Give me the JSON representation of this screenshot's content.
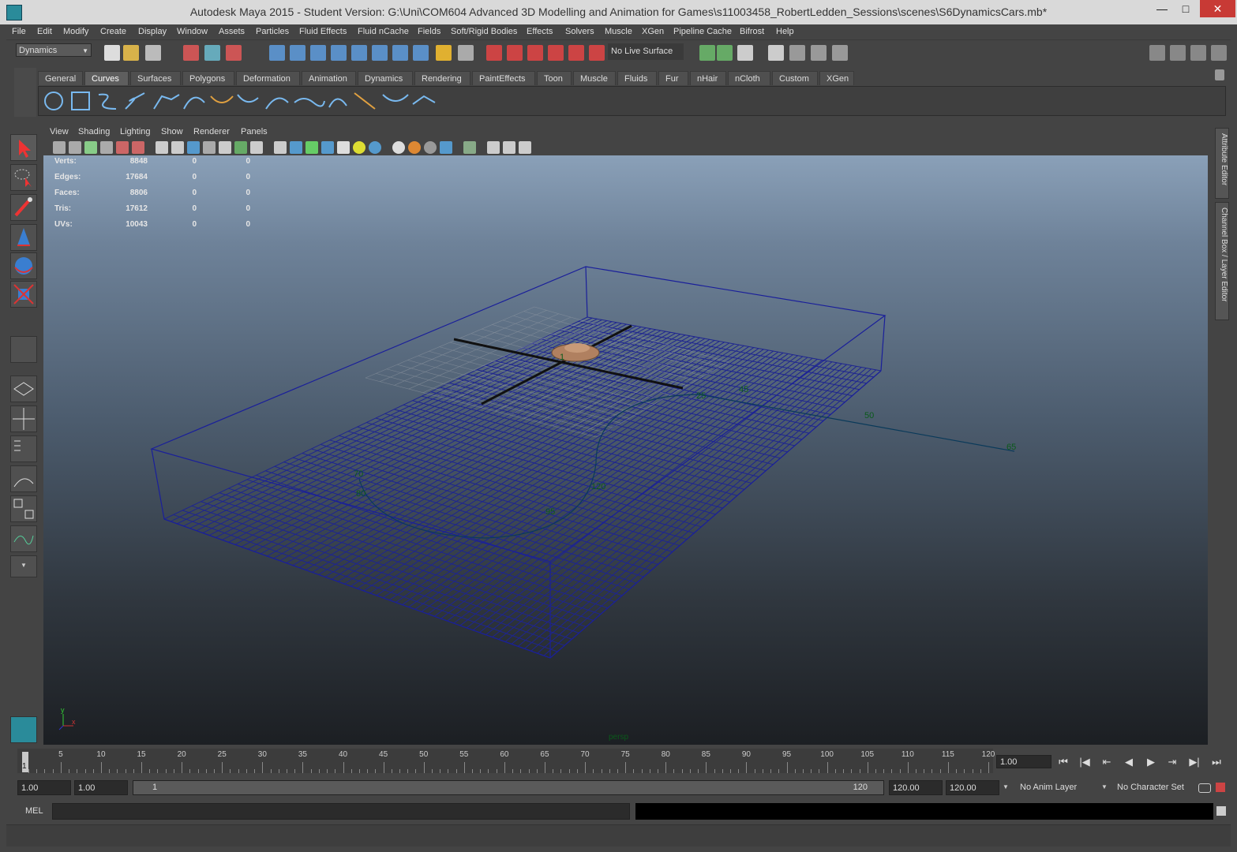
{
  "window": {
    "title": "Autodesk Maya 2015 - Student Version: G:\\Uni\\COM604 Advanced 3D Modelling and Animation for Games\\s11003458_RobertLedden_Sessions\\scenes\\S6DynamicsCars.mb*",
    "minimize": "—",
    "maximize": "□",
    "close": "✕"
  },
  "menu": [
    "File",
    "Edit",
    "Modify",
    "Create",
    "Display",
    "Window",
    "Assets",
    "Particles",
    "Fluid Effects",
    "Fluid nCache",
    "Fields",
    "Soft/Rigid Bodies",
    "Effects",
    "Solvers",
    "Muscle",
    "XGen",
    "Pipeline Cache",
    "Bifrost",
    "Help"
  ],
  "statusline": {
    "mode": "Dynamics",
    "live_surface": "No Live Surface"
  },
  "shelf": {
    "tabs": [
      "General",
      "Curves",
      "Surfaces",
      "Polygons",
      "Deformation",
      "Animation",
      "Dynamics",
      "Rendering",
      "PaintEffects",
      "Toon",
      "Muscle",
      "Fluids",
      "Fur",
      "nHair",
      "nCloth",
      "Custom",
      "XGen"
    ],
    "active_tab": "Curves"
  },
  "panel_menu": [
    "View",
    "Shading",
    "Lighting",
    "Show",
    "Renderer",
    "Panels"
  ],
  "hud": [
    {
      "label": "Verts:",
      "value": "8848",
      "a": "0",
      "b": "0"
    },
    {
      "label": "Edges:",
      "value": "17684",
      "a": "0",
      "b": "0"
    },
    {
      "label": "Faces:",
      "value": "8806",
      "a": "0",
      "b": "0"
    },
    {
      "label": "Tris:",
      "value": "17612",
      "a": "0",
      "b": "0"
    },
    {
      "label": "UVs:",
      "value": "10043",
      "a": "0",
      "b": "0"
    }
  ],
  "viewport": {
    "camera_label": "persp",
    "path_frame_labels": [
      "1",
      "25",
      "45",
      "50",
      "65",
      "70",
      "80",
      "95",
      "120"
    ],
    "axis_labels": {
      "y": "y",
      "x": "x"
    }
  },
  "side_tabs": [
    "Attribute Editor",
    "Channel Box / Layer Editor"
  ],
  "timeline": {
    "ticks": [
      "5",
      "10",
      "15",
      "20",
      "25",
      "30",
      "35",
      "40",
      "45",
      "50",
      "55",
      "60",
      "65",
      "70",
      "75",
      "80",
      "85",
      "90",
      "95",
      "100",
      "105",
      "110",
      "115",
      "120"
    ],
    "current_frame_marker": "1",
    "current_frame": "1.00",
    "playback_buttons": [
      "⏮",
      "|◀",
      "⇤",
      "◀",
      "▶",
      "⇥",
      "▶|",
      "⏭"
    ]
  },
  "range": {
    "start": "1.00",
    "playback_start": "1.00",
    "slider_start": "1",
    "slider_end": "120",
    "playback_end": "120.00",
    "end": "120.00",
    "anim_layer": "No Anim Layer",
    "character_set": "No Character Set"
  },
  "command_line": {
    "language": "MEL",
    "value": ""
  },
  "help_line": {
    "text": ""
  },
  "colors": {
    "viewport_top": "#8aa0b8",
    "viewport_bottom": "#1c1f23",
    "grid": "#1a1f7a",
    "path_label": "#0a5a1a"
  }
}
